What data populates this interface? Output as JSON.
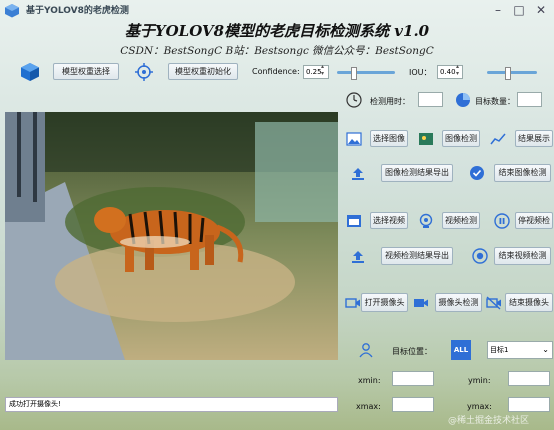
{
  "window": {
    "title": "基于YOLOV8的老虎检测"
  },
  "header": {
    "title": "基于YOLOV8模型的老虎目标检测系统 v1.0",
    "subtitle": "CSDN：BestSongC   B站：Bestsongc   微信公众号：BestSongC"
  },
  "toolbar": {
    "model_select_label": "模型权重选择",
    "model_init_label": "模型权重初始化",
    "confidence_label": "Confidence:",
    "confidence_value": "0.25",
    "confidence_level": 0.25,
    "iou_label": "IOU：",
    "iou_value": "0.40",
    "iou_level": 0.4
  },
  "stats": {
    "time_label": "检测用时：",
    "time_value": "",
    "count_label": "目标数量：",
    "count_value": ""
  },
  "image_group": {
    "select_image": "选择图像",
    "detect_image": "图像检测",
    "show_result": "结果展示",
    "export_result": "图像检测结果导出",
    "end_detect": "结束图像检测"
  },
  "video_group": {
    "select_video": "选择视频",
    "detect_video": "视频检测",
    "pause_video": "停视频检",
    "export_result": "视频检测结果导出",
    "end_detect": "结束视频检测"
  },
  "camera_group": {
    "open_camera": "打开摄像头",
    "camera_detect": "摄像头检测",
    "close_camera": "结束摄像头"
  },
  "target": {
    "position_label": "目标位置：",
    "all_badge": "ALL",
    "select_value": "目标1"
  },
  "coords": {
    "xmin_label": "xmin:",
    "ymin_label": "ymin:",
    "xmax_label": "xmax:",
    "ymax_label": "ymax:"
  },
  "status": {
    "message": "成功打开摄像头!"
  },
  "watermark": "@稀土掘金技术社区",
  "colors": {
    "accent": "#2f6fd6",
    "slider": "#6aa5d8",
    "title_text": "#111111"
  }
}
